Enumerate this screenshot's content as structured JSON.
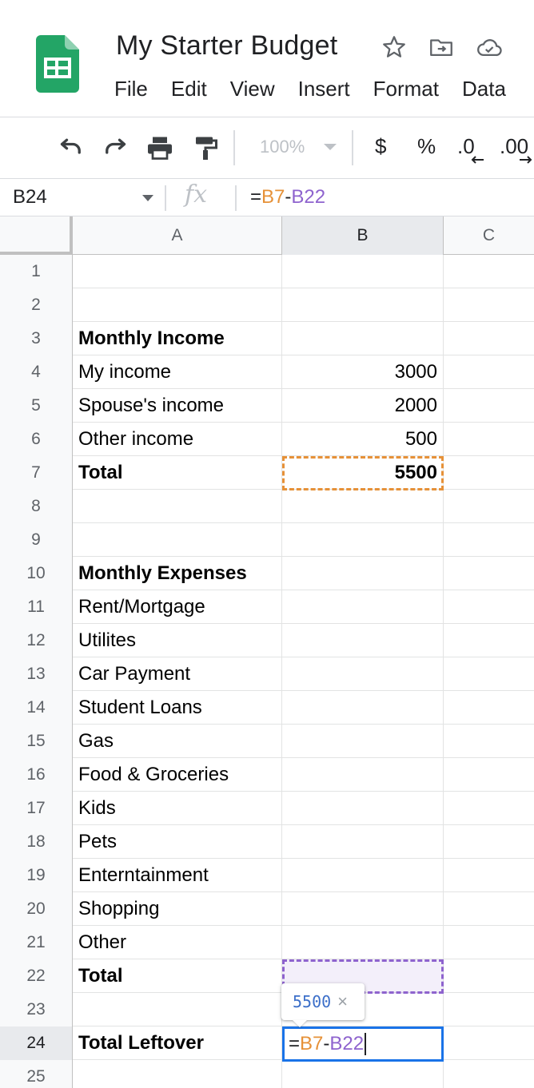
{
  "app": {
    "doc_title": "My Starter Budget",
    "brand_color": "#0f9d58",
    "title_icons": [
      "star-icon",
      "move-to-folder-icon",
      "cloud-saved-icon"
    ]
  },
  "menu": [
    "File",
    "Edit",
    "View",
    "Insert",
    "Format",
    "Data"
  ],
  "toolbar": {
    "zoom": "100%",
    "currency_label": "$",
    "percent_label": "%",
    "decrease_decimals_label": ".0",
    "increase_decimals_label": ".00",
    "icons": [
      "undo-icon",
      "redo-icon",
      "print-icon",
      "paint-format-icon"
    ]
  },
  "formula_bar": {
    "name_box": "B24",
    "fx_label": "fx",
    "formula_eq": "=",
    "formula_ref1": "B7",
    "formula_op": "-",
    "formula_ref2": "B22"
  },
  "columns": [
    "A",
    "B",
    "C"
  ],
  "active_column": "B",
  "active_row": "24",
  "rows": [
    {
      "num": "1",
      "a": "",
      "b": "",
      "bold": false
    },
    {
      "num": "2",
      "a": "",
      "b": "",
      "bold": false
    },
    {
      "num": "3",
      "a": "Monthly Income",
      "b": "",
      "bold": true
    },
    {
      "num": "4",
      "a": "My income",
      "b": "3000",
      "bold": false
    },
    {
      "num": "5",
      "a": "Spouse's income",
      "b": "2000",
      "bold": false
    },
    {
      "num": "6",
      "a": "Other income",
      "b": "500",
      "bold": false
    },
    {
      "num": "7",
      "a": "Total",
      "b": "5500",
      "bold": true
    },
    {
      "num": "8",
      "a": "",
      "b": "",
      "bold": false
    },
    {
      "num": "9",
      "a": "",
      "b": "",
      "bold": false
    },
    {
      "num": "10",
      "a": "Monthly Expenses",
      "b": "",
      "bold": true
    },
    {
      "num": "11",
      "a": "Rent/Mortgage",
      "b": "",
      "bold": false
    },
    {
      "num": "12",
      "a": "Utilites",
      "b": "",
      "bold": false
    },
    {
      "num": "13",
      "a": "Car Payment",
      "b": "",
      "bold": false
    },
    {
      "num": "14",
      "a": "Student Loans",
      "b": "",
      "bold": false
    },
    {
      "num": "15",
      "a": "Gas",
      "b": "",
      "bold": false
    },
    {
      "num": "16",
      "a": "Food & Groceries",
      "b": "",
      "bold": false
    },
    {
      "num": "17",
      "a": "Kids",
      "b": "",
      "bold": false
    },
    {
      "num": "18",
      "a": "Pets",
      "b": "",
      "bold": false
    },
    {
      "num": "19",
      "a": "Enterntainment",
      "b": "",
      "bold": false
    },
    {
      "num": "20",
      "a": "Shopping",
      "b": "",
      "bold": false
    },
    {
      "num": "21",
      "a": "Other",
      "b": "",
      "bold": false
    },
    {
      "num": "22",
      "a": "Total",
      "b": "",
      "bold": true
    },
    {
      "num": "23",
      "a": "",
      "b": "",
      "bold": false
    },
    {
      "num": "24",
      "a": "Total Leftover",
      "b": "",
      "bold": true
    },
    {
      "num": "25",
      "a": "",
      "b": "",
      "bold": false
    }
  ],
  "editing_cell": {
    "eq": "=",
    "ref1": "B7",
    "op": "-",
    "ref2": "B22"
  },
  "preview_tooltip": {
    "value": "5500",
    "close_glyph": "×"
  },
  "reference_colors": {
    "first_ref": "#e69138",
    "second_ref": "#8e63ce",
    "active_cell": "#1a73e8"
  }
}
